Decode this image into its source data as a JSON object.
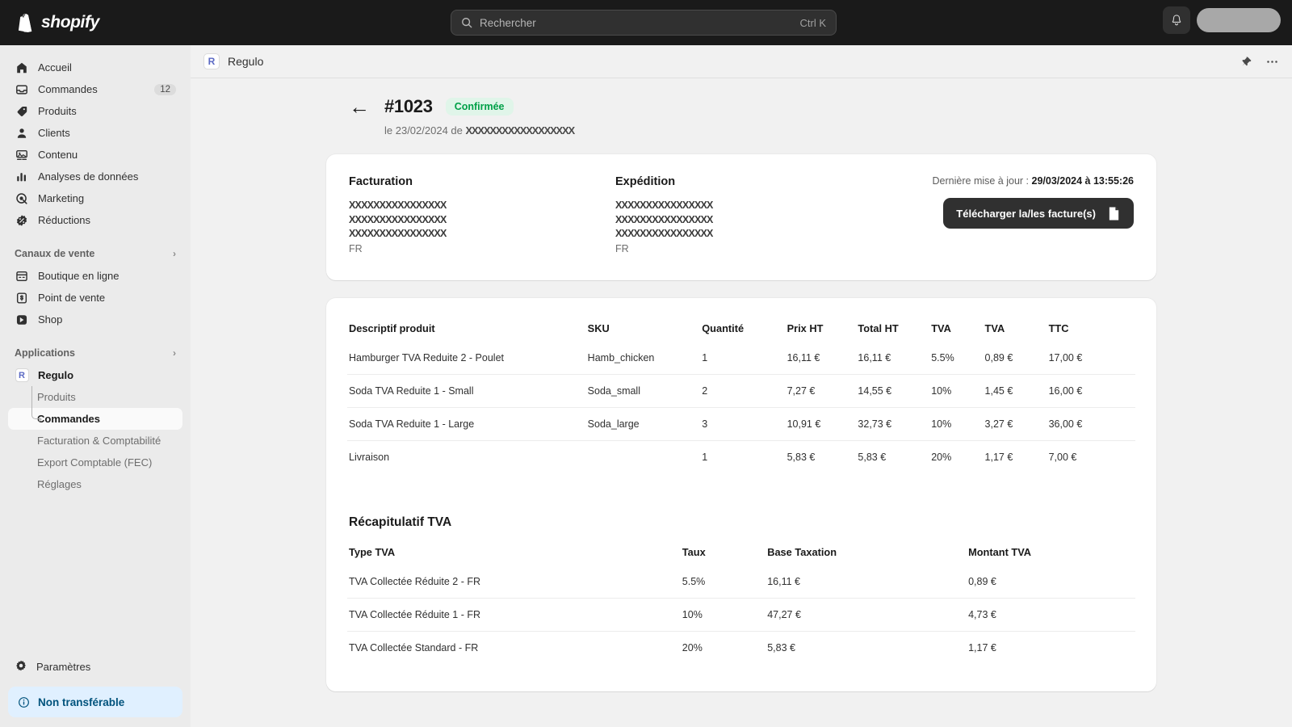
{
  "topbar": {
    "brand": "shopify",
    "brand_icon": "shopify-bag-icon",
    "search": {
      "placeholder": "Rechercher",
      "shortcut": "Ctrl K",
      "icon": "search-icon"
    },
    "notifications_icon": "bell-icon",
    "avatar": "account-avatar"
  },
  "sidebar": {
    "items": [
      {
        "label": "Accueil",
        "icon": "home-icon"
      },
      {
        "label": "Commandes",
        "icon": "orders-inbox-icon",
        "count": "12"
      },
      {
        "label": "Produits",
        "icon": "tag-icon"
      },
      {
        "label": "Clients",
        "icon": "person-icon"
      },
      {
        "label": "Contenu",
        "icon": "content-image-icon"
      },
      {
        "label": "Analyses de données",
        "icon": "bar-chart-icon"
      },
      {
        "label": "Marketing",
        "icon": "marketing-target-icon"
      },
      {
        "label": "Réductions",
        "icon": "discount-percent-icon"
      }
    ],
    "sales_channels": {
      "label": "Canaux de vente",
      "chevron": "chevron-right-icon"
    },
    "channels": [
      {
        "label": "Boutique en ligne",
        "icon": "online-store-icon"
      },
      {
        "label": "Point de vente",
        "icon": "point-of-sale-icon"
      },
      {
        "label": "Shop",
        "icon": "shop-icon"
      }
    ],
    "applications": {
      "label": "Applications",
      "chevron": "chevron-right-icon"
    },
    "app": {
      "label": "Regulo",
      "icon": "regulo-app-icon",
      "mark": "R"
    },
    "app_children": [
      {
        "label": "Produits",
        "active": false
      },
      {
        "label": "Commandes",
        "active": true
      },
      {
        "label": "Facturation & Comptabilité",
        "active": false
      },
      {
        "label": "Export Comptable (FEC)",
        "active": false
      },
      {
        "label": "Réglages",
        "active": false
      }
    ],
    "settings": {
      "label": "Paramètres",
      "icon": "gear-icon"
    },
    "transfer_banner": {
      "label": "Non transférable",
      "icon": "info-circle-icon"
    }
  },
  "appbar": {
    "title": "Regulo",
    "mark": "R",
    "pin_icon": "pin-icon",
    "more_icon": "ellipsis-horizontal-icon"
  },
  "order": {
    "back_icon": "arrow-left-icon",
    "number": "#1023",
    "status": "Confirmée",
    "subtitle_prefix": "le 23/02/2024 de ",
    "subtitle_customer": "XXXXXXXXXXXXXXXXXX"
  },
  "addresses": {
    "billing": {
      "title": "Facturation",
      "lines": [
        "XXXXXXXXXXXXXXXX",
        "XXXXXXXXXXXXXXXX",
        "XXXXXXXXXXXXXXXX"
      ],
      "country": "FR"
    },
    "shipping": {
      "title": "Expédition",
      "lines": [
        "XXXXXXXXXXXXXXXX",
        "XXXXXXXXXXXXXXXX",
        "XXXXXXXXXXXXXXXX"
      ],
      "country": "FR"
    },
    "last_update_label": "Dernière mise à jour : ",
    "last_update_value": "29/03/2024 à 13:55:26",
    "download_button": "Télécharger la/les facture(s)",
    "download_icon": "document-icon"
  },
  "products_table": {
    "headers": [
      "Descriptif produit",
      "SKU",
      "Quantité",
      "Prix HT",
      "Total HT",
      "TVA",
      "TVA",
      "TTC"
    ],
    "rows": [
      [
        "Hamburger TVA Reduite 2 - Poulet",
        "Hamb_chicken",
        "1",
        "16,11 €",
        "16,11 €",
        "5.5%",
        "0,89 €",
        "17,00 €"
      ],
      [
        "Soda TVA Reduite 1 - Small",
        "Soda_small",
        "2",
        "7,27 €",
        "14,55 €",
        "10%",
        "1,45 €",
        "16,00 €"
      ],
      [
        "Soda TVA Reduite 1 - Large",
        "Soda_large",
        "3",
        "10,91 €",
        "32,73 €",
        "10%",
        "3,27 €",
        "36,00 €"
      ],
      [
        "Livraison",
        "",
        "1",
        "5,83 €",
        "5,83 €",
        "20%",
        "1,17 €",
        "7,00 €"
      ]
    ]
  },
  "vat_recap": {
    "title": "Récapitulatif TVA",
    "headers": [
      "Type TVA",
      "Taux",
      "Base Taxation",
      "Montant TVA"
    ],
    "rows": [
      [
        "TVA Collectée Réduite 2 - FR",
        "5.5%",
        "16,11 €",
        "0,89 €"
      ],
      [
        "TVA Collectée Réduite 1 - FR",
        "10%",
        "47,27 €",
        "4,73 €"
      ],
      [
        "TVA Collectée Standard - FR",
        "20%",
        "5,83 €",
        "1,17 €"
      ]
    ]
  },
  "colors": {
    "topbar_bg": "#1a1a1a",
    "sidebar_bg": "#ebebeb",
    "main_bg": "#f1f1f1",
    "status_green": "#00a047",
    "status_green_bg": "#e0f5e9",
    "banner_blue": "#e0f0ff",
    "banner_text": "#00527c",
    "app_accent": "#5c6ac4"
  }
}
